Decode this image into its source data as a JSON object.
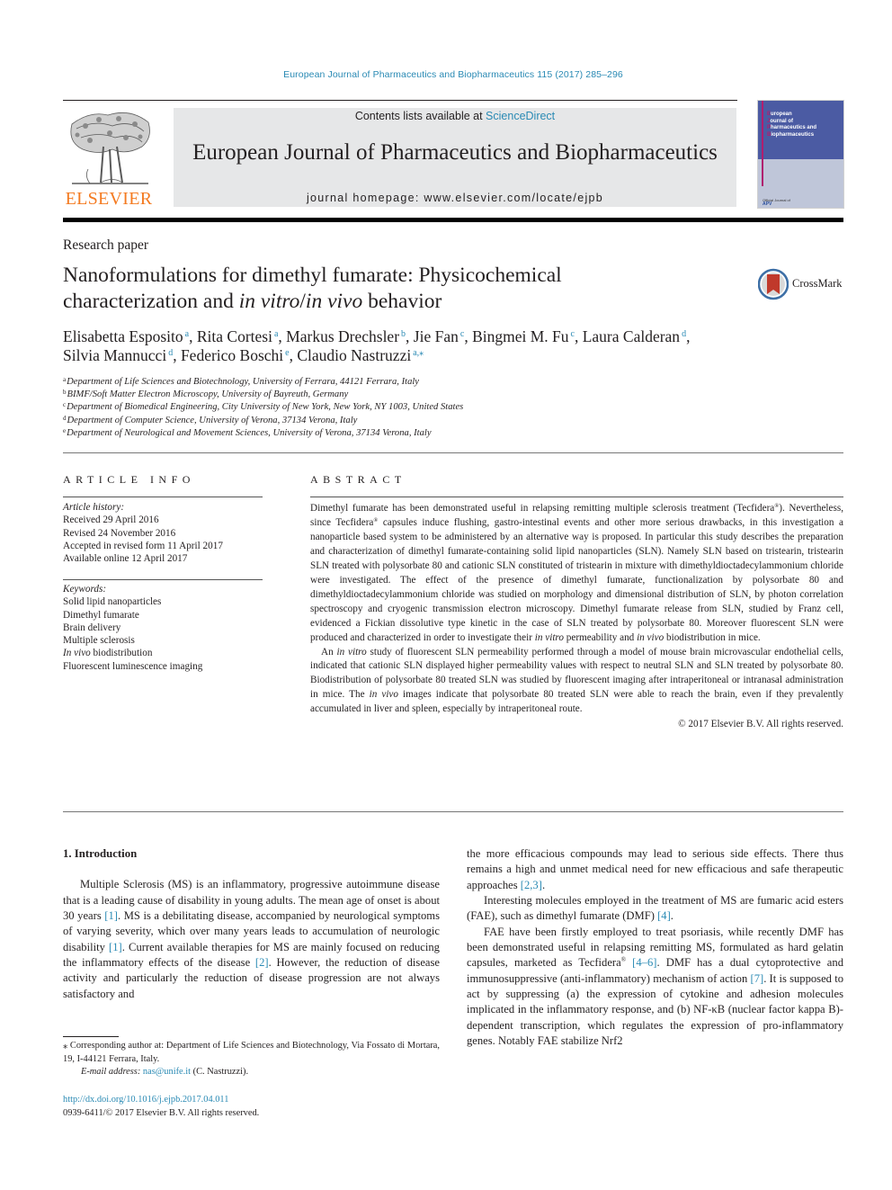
{
  "running_head": "European Journal of Pharmaceutics and Biopharmaceutics 115 (2017) 285–296",
  "masthead": {
    "contents_prefix": "Contents lists available at ",
    "contents_link": "ScienceDirect",
    "journal_name": "European Journal of Pharmaceutics and Biopharmaceutics",
    "homepage": "journal homepage: www.elsevier.com/locate/ejpb",
    "publisher_logo_text": "ELSEVIER",
    "cover": {
      "title_lines": [
        {
          "initial": "E",
          "rest": "uropean"
        },
        {
          "initial": "J",
          "rest": "ournal of"
        },
        {
          "initial": "P",
          "rest": "harmaceutics and"
        },
        {
          "initial": "B",
          "rest": "iopharmaceutics"
        }
      ],
      "footer": "Official Journal of",
      "apv": "APV"
    }
  },
  "article": {
    "type": "Research paper",
    "title_line1": "Nanoformulations for dimethyl fumarate: Physicochemical",
    "title_line2_prefix": "characterization and ",
    "title_line2_italic1": "in vitro",
    "title_line2_sep": "/",
    "title_line2_italic2": "in vivo",
    "title_line2_suffix": " behavior",
    "crossmark_label": "CrossMark",
    "authors": [
      {
        "name": "Elisabetta Esposito",
        "aff": "a",
        "sep": ", "
      },
      {
        "name": "Rita Cortesi",
        "aff": "a",
        "sep": ", "
      },
      {
        "name": "Markus Drechsler",
        "aff": "b",
        "sep": ", "
      },
      {
        "name": "Jie Fan",
        "aff": "c",
        "sep": ", "
      },
      {
        "name": "Bingmei M. Fu",
        "aff": "c",
        "sep": ", "
      },
      {
        "name": "Laura Calderan",
        "aff": "d",
        "sep": ","
      },
      {
        "name": "Silvia Mannucci",
        "aff": "d",
        "sep": ", "
      },
      {
        "name": "Federico Boschi",
        "aff": "e",
        "sep": ", "
      },
      {
        "name": "Claudio Nastruzzi",
        "aff": "a,⁎",
        "sep": ""
      }
    ],
    "affiliations": [
      {
        "key": "a",
        "text": "Department of Life Sciences and Biotechnology, University of Ferrara, 44121 Ferrara, Italy"
      },
      {
        "key": "b",
        "text": "BIMF/Soft Matter Electron Microscopy, University of Bayreuth, Germany"
      },
      {
        "key": "c",
        "text": "Department of Biomedical Engineering, City University of New York, New York, NY 1003, United States"
      },
      {
        "key": "d",
        "text": "Department of Computer Science, University of Verona, 37134 Verona, Italy"
      },
      {
        "key": "e",
        "text": "Department of Neurological and Movement Sciences, University of Verona, 37134 Verona, Italy"
      }
    ]
  },
  "article_info": {
    "heading": "ARTICLE INFO",
    "history_label": "Article history:",
    "history": [
      "Received 29 April 2016",
      "Revised 24 November 2016",
      "Accepted in revised form 11 April 2017",
      "Available online 12 April 2017"
    ],
    "keywords_label": "Keywords:",
    "keywords": [
      "Solid lipid nanoparticles",
      "Dimethyl fumarate",
      "Brain delivery",
      "Multiple sclerosis",
      "In vivo biodistribution",
      "Fluorescent luminescence imaging"
    ]
  },
  "abstract": {
    "heading": "ABSTRACT",
    "p1_a": "Dimethyl fumarate has been demonstrated useful in relapsing remitting multiple sclerosis treatment (Tecfidera",
    "p1_b": "). Nevertheless, since Tecfidera",
    "p1_c": " capsules induce flushing, gastro-intestinal events and other more serious drawbacks, in this investigation a nanoparticle based system to be administered by an alternative way is proposed. In particular this study describes the preparation and characterization of dimethyl fumarate-containing solid lipid nanoparticles (SLN). Namely SLN based on tristearin, tristearin SLN treated with polysorbate 80 and cationic SLN constituted of tristearin in mixture with dimethyldioctadecylammonium chloride were investigated. The effect of the presence of dimethyl fumarate, functionalization by polysorbate 80 and dimethyldioctadecylammonium chloride was studied on morphology and dimensional distribution of SLN, by photon correlation spectroscopy and cryogenic transmission electron microscopy. Dimethyl fumarate release from SLN, studied by Franz cell, evidenced a Fickian dissolutive type kinetic in the case of SLN treated by polysorbate 80. Moreover fluorescent SLN were produced and characterized in order to investigate their ",
    "p1_it1": "in vitro",
    "p1_d": " permeability and ",
    "p1_it2": "in vivo",
    "p1_e": " biodistribution in mice.",
    "reg_mark": "®",
    "p2_a": "An ",
    "p2_it1": "in vitro",
    "p2_b": " study of fluorescent SLN permeability performed through a model of mouse brain microvascular endothelial cells, indicated that cationic SLN displayed higher permeability values with respect to neutral SLN and SLN treated by polysorbate 80. Biodistribution of polysorbate 80 treated SLN was studied by fluorescent imaging after intraperitoneal or intranasal administration in mice. The ",
    "p2_it2": "in vivo",
    "p2_c": " images indicate that polysorbate 80 treated SLN were able to reach the brain, even if they prevalently accumulated in liver and spleen, especially by intraperitoneal route.",
    "copyright": "© 2017 Elsevier B.V. All rights reserved."
  },
  "body": {
    "section_title": "1. Introduction",
    "left_p1": [
      {
        "t": "Multiple Sclerosis (MS) is an inflammatory, progressive autoimmune disease that is a leading cause of disability in young adults. The mean age of onset is about 30 years "
      },
      {
        "ref": "[1]"
      },
      {
        "t": ". MS is a debilitating disease, accompanied by neurological symptoms of varying severity, which over many years leads to accumulation of neurologic disability "
      },
      {
        "ref": "[1]"
      },
      {
        "t": ". Current available therapies for MS are mainly focused on reducing the inflammatory effects of the disease "
      },
      {
        "ref": "[2]"
      },
      {
        "t": ". However, the reduction of disease activity and particularly the reduction of disease progression are not always satisfactory and"
      }
    ],
    "right_p1": [
      {
        "t": "the more efficacious compounds may lead to serious side effects. There thus remains a high and unmet medical need for new efficacious and safe therapeutic approaches "
      },
      {
        "ref": "[2,3]"
      },
      {
        "t": "."
      }
    ],
    "right_p2": [
      {
        "t": "Interesting molecules employed in the treatment of MS are fumaric acid esters (FAE), such as dimethyl fumarate (DMF) "
      },
      {
        "ref": "[4]"
      },
      {
        "t": "."
      }
    ],
    "right_p3": [
      {
        "t": "FAE have been firstly employed to treat psoriasis, while recently DMF has been demonstrated useful in relapsing remitting MS, formulated as hard gelatin capsules, marketed as Tecfidera"
      },
      {
        "sup": "®"
      },
      {
        "t": " "
      },
      {
        "ref": "[4–6]"
      },
      {
        "t": ". DMF has a dual cytoprotective and immunosuppressive (anti-inflammatory) mechanism of action "
      },
      {
        "ref": "[7]"
      },
      {
        "t": ". It is supposed to act by suppressing (a) the expression of cytokine and adhesion molecules implicated in the inflammatory response, and (b) NF-κB (nuclear factor kappa B)-dependent transcription, which regulates the expression of pro-inflammatory genes. Notably FAE stabilize Nrf2"
      }
    ]
  },
  "footnote": {
    "corresponding": "⁎ Corresponding author at: Department of Life Sciences and Biotechnology, Via Fossato di Mortara, 19, I-44121 Ferrara, Italy.",
    "email_label": "E-mail address: ",
    "email": "nas@unife.it",
    "email_suffix": " (C. Nastruzzi).",
    "doi": "http://dx.doi.org/10.1016/j.ejpb.2017.04.011",
    "issn": "0939-6411/© 2017 Elsevier B.V. All rights reserved."
  },
  "colors": {
    "link": "#2a8ab4",
    "elsevier_orange": "#f47a20",
    "masthead_bg": "#e6e7e8",
    "cover_blue": "#4b5ba3",
    "cover_magenta": "#b01e6e"
  }
}
